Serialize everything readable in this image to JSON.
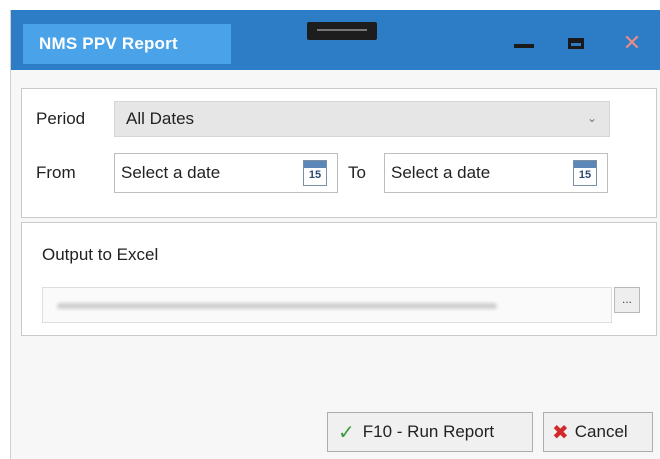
{
  "window": {
    "title": "NMS PPV Report"
  },
  "period": {
    "label": "Period",
    "selected": "All Dates"
  },
  "from": {
    "label": "From",
    "placeholder": "Select a date",
    "calendar_day": "15"
  },
  "to": {
    "label": "To",
    "placeholder": "Select a date",
    "calendar_day": "15"
  },
  "output": {
    "label": "Output to Excel",
    "browse_label": "..."
  },
  "buttons": {
    "run": "F10 - Run Report",
    "cancel": "Cancel"
  },
  "icons": {
    "run": "checkmark-icon",
    "cancel": "x-icon"
  },
  "colors": {
    "titlebar": "#2d7dc6",
    "title_tab": "#4aa3e8",
    "check": "#3a9a3a",
    "cancel_x": "#d22a2a"
  }
}
